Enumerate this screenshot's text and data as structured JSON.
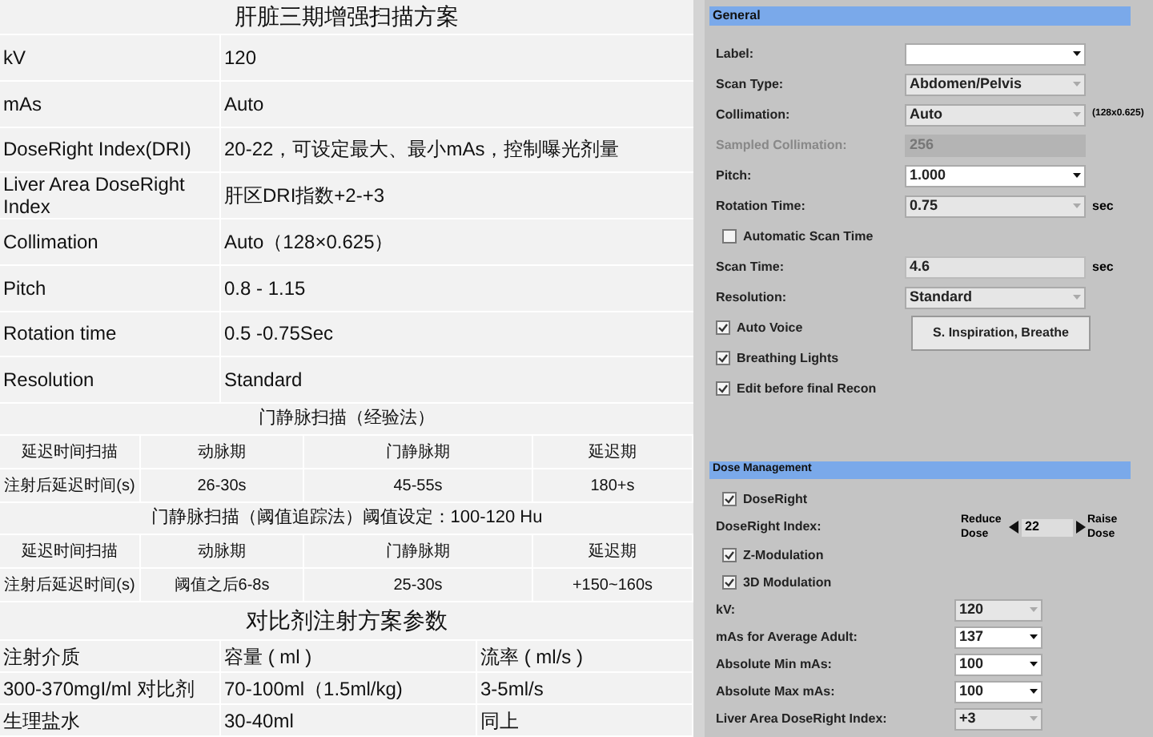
{
  "protocol_table": {
    "title": "肝脏三期增强扫描方案",
    "rows": [
      {
        "label": "kV",
        "value": "120"
      },
      {
        "label": "mAs",
        "value": "Auto"
      },
      {
        "label": "DoseRight Index(DRI)",
        "value": "20-22，可设定最大、最小mAs，控制曝光剂量"
      },
      {
        "label": "Liver Area DoseRight Index",
        "value": "肝区DRI指数+2-+3"
      },
      {
        "label": "Collimation",
        "value": "Auto（128×0.625）"
      },
      {
        "label": "Pitch",
        "value": "0.8 - 1.15"
      },
      {
        "label": "Rotation time",
        "value": "0.5 -0.75Sec"
      },
      {
        "label": "Resolution",
        "value": "Standard"
      }
    ]
  },
  "portal_tables": [
    {
      "title": "门静脉扫描（经验法）",
      "rows": [
        {
          "cells": [
            "延迟时间扫描",
            "动脉期",
            "门静脉期",
            "延迟期"
          ]
        },
        {
          "cells": [
            "注射后延迟时间(s)",
            "26-30s",
            "45-55s",
            "180+s"
          ]
        }
      ]
    },
    {
      "title": "门静脉扫描（阈值追踪法）阈值设定：100-120 Hu",
      "rows": [
        {
          "cells": [
            "延迟时间扫描",
            "动脉期",
            "门静脉期",
            "延迟期"
          ]
        },
        {
          "cells": [
            "注射后延迟时间(s)",
            "阈值之后6-8s",
            "25-30s",
            "+150~160s"
          ]
        }
      ]
    }
  ],
  "contrast_table": {
    "title": "对比剂注射方案参数",
    "rows": [
      {
        "cells": [
          "注射介质",
          "容量 ( ml )",
          "流率 ( ml/s )"
        ]
      },
      {
        "cells": [
          "300-370mgI/ml 对比剂",
          "70-100ml（1.5ml/kg)",
          "3-5ml/s"
        ]
      },
      {
        "cells": [
          "生理盐水",
          "30-40ml",
          "同上"
        ]
      }
    ]
  },
  "general": {
    "title": "General",
    "fields": [
      {
        "kind": "select",
        "label": "Label:",
        "editable": true
      },
      {
        "kind": "select",
        "label": "Scan Type:",
        "value": "Abdomen/Pelvis",
        "editable": false
      },
      {
        "kind": "select",
        "label": "Collimation:",
        "value": "Auto",
        "editable": false,
        "unit": "(128x0.625)"
      },
      {
        "kind": "input",
        "label": "Sampled Collimation:",
        "value": "256",
        "disabled": true
      },
      {
        "kind": "select",
        "label": "Pitch:",
        "value": "1.000",
        "editable": true
      },
      {
        "kind": "select",
        "label": "Rotation Time:",
        "value": "0.75",
        "editable": false,
        "unit": "sec"
      },
      {
        "kind": "checkbox",
        "label": "Automatic Scan Time",
        "checked": false
      },
      {
        "kind": "input",
        "label": "Scan Time:",
        "value": "4.6",
        "disabled": false,
        "unit": "sec"
      },
      {
        "kind": "select",
        "label": "Resolution:",
        "value": "Standard",
        "editable": false
      }
    ],
    "options": [
      {
        "label": "Auto Voice",
        "checked": true
      },
      {
        "label": "Breathing Lights",
        "checked": true
      },
      {
        "label": "Edit before final Recon",
        "checked": true
      }
    ],
    "button": "S. Inspiration, Breathe"
  },
  "dose": {
    "title": "Dose Management",
    "fields": [
      {
        "kind": "checkbox",
        "label": "DoseRight",
        "checked": true
      },
      {
        "kind": "stepper",
        "label": "DoseRight Index:",
        "lower": "Reduce Dose",
        "value": "22",
        "raise": "Raise Dose"
      },
      {
        "kind": "checkbox",
        "label": "Z-Modulation",
        "checked": true
      },
      {
        "kind": "checkbox",
        "label": "3D Modulation",
        "checked": true
      },
      {
        "kind": "select",
        "label": "kV:",
        "value": "120",
        "editable": false
      },
      {
        "kind": "select",
        "label": "mAs for Average Adult:",
        "value": "137",
        "editable": true
      },
      {
        "kind": "select",
        "label": "Absolute Min mAs:",
        "value": "100",
        "editable": true
      },
      {
        "kind": "select",
        "label": "Absolute Max mAs:",
        "value": "100",
        "editable": true
      },
      {
        "kind": "select",
        "label": "Liver Area DoseRight Index:",
        "value": "+3",
        "editable": false
      }
    ]
  }
}
